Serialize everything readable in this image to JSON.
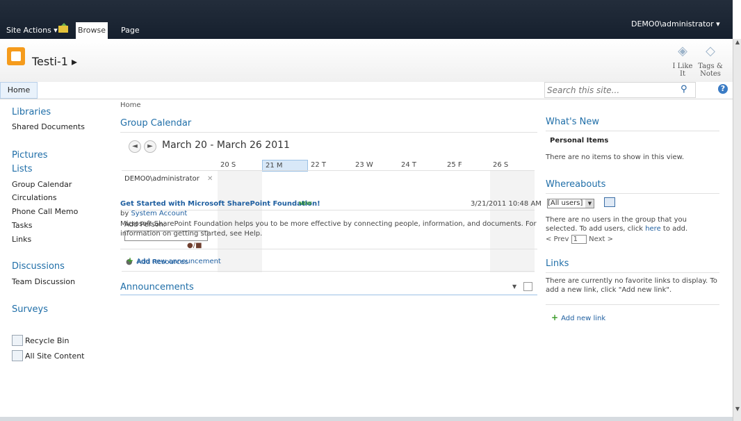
{
  "topbar": {
    "site_actions": "Site Actions ▾",
    "tab_browse": "Browse",
    "tab_page": "Page",
    "user": "DEMO0\\administrator ▾"
  },
  "header": {
    "site_title": "Testi-1 ▸",
    "like_label": "I Like It",
    "tags_label": "Tags & Notes"
  },
  "topnav": {
    "home": "Home",
    "search_placeholder": "Search this site..."
  },
  "left": {
    "libraries": "Libraries",
    "shared_docs": "Shared Documents",
    "pictures": "Pictures",
    "lists": "Lists",
    "list_items": [
      "Group Calendar",
      "Circulations",
      "Phone Call Memo",
      "Tasks",
      "Links"
    ],
    "discussions": "Discussions",
    "team_discussion": "Team Discussion",
    "surveys": "Surveys",
    "recycle_bin": "Recycle Bin",
    "all_content": "All Site Content"
  },
  "main": {
    "breadcrumb": "Home",
    "calendar_title": "Group Calendar",
    "date_range": "March 20 - March 26 2011",
    "days": [
      "20 S",
      "21 M",
      "22 T",
      "23 W",
      "24 T",
      "25 F",
      "26 S"
    ],
    "person": "DEMO0\\administrator",
    "add_person": "Add Person:",
    "add_resources": "Add Resources",
    "announcements_title": "Announcements",
    "ann_title": "Get Started with Microsoft SharePoint Foundation!",
    "ann_new": "NEW",
    "ann_date": "3/21/2011 10:48 AM",
    "ann_by_prefix": "by ",
    "ann_by": "System Account",
    "ann_body": "Microsoft SharePoint Foundation helps you to be more effective by connecting people, information, and documents. For information on getting started, see Help.",
    "add_announcement": "Add new announcement"
  },
  "right": {
    "whats_new": "What's New",
    "personal_items": "Personal Items",
    "no_items": "There are no items to show in this view.",
    "whereabouts": "Whereabouts",
    "users_select": "[All users]",
    "users_text": "There are no users in the group that you selected. To add users, click ",
    "users_link": "here",
    "users_suffix": " to add.",
    "pager_prev": "< Prev",
    "pager_num": "1",
    "pager_next": "Next >",
    "links": "Links",
    "links_text": "There are currently no favorite links to display. To add a new link, click \"Add new link\".",
    "add_link": "Add new link"
  }
}
